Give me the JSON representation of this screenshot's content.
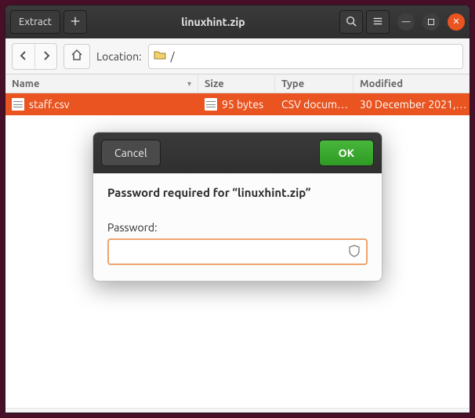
{
  "titlebar": {
    "extract_label": "Extract",
    "title": "linuxhint.zip"
  },
  "nav": {
    "location_label": "Location:",
    "path": "/"
  },
  "columns": {
    "name": "Name",
    "size": "Size",
    "type": "Type",
    "modified": "Modified"
  },
  "files": [
    {
      "name": "staff.csv",
      "size": "95 bytes",
      "type": "CSV docum…",
      "modified": "30 December 2021,…"
    }
  ],
  "dialog": {
    "cancel_label": "Cancel",
    "ok_label": "OK",
    "heading": "Password required for “linuxhint.zip”",
    "password_label": "Password:",
    "password_value": ""
  }
}
